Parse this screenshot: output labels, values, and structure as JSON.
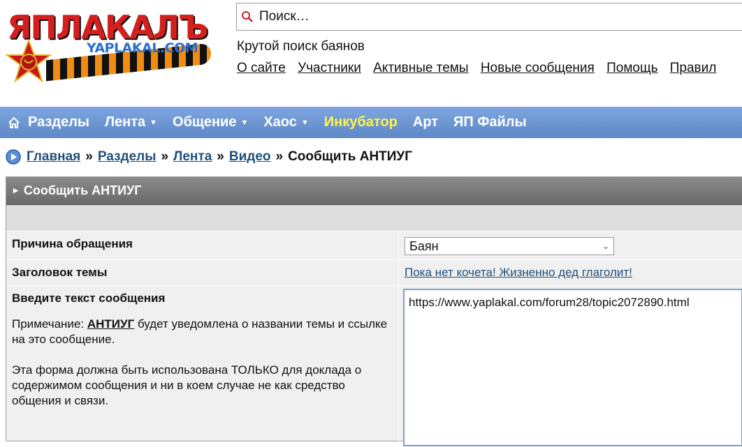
{
  "logo": {
    "text": "ЯПЛАКАЛЪ",
    "sub": "YAPLAKAL.COM"
  },
  "search": {
    "placeholder": "Поиск…"
  },
  "tagline": "Крутой поиск баянов",
  "top_links": [
    "О сайте",
    "Участники",
    "Активные темы",
    "Новые сообщения",
    "Помощь",
    "Правил"
  ],
  "nav": {
    "items": [
      {
        "label": "Разделы"
      },
      {
        "label": "Лента",
        "caret": "▼"
      },
      {
        "label": "Общение",
        "caret": "▼"
      },
      {
        "label": "Хаос",
        "caret": "▼"
      },
      {
        "label": "Инкубатор",
        "highlight_color": "#fff44a"
      },
      {
        "label": "Арт"
      },
      {
        "label": "ЯП Файлы"
      }
    ]
  },
  "breadcrumb": {
    "links": [
      "Главная",
      "Разделы",
      "Лента",
      "Видео"
    ],
    "separator": "»",
    "current": "Сообщить АНТИУГ"
  },
  "panel": {
    "title": "Сообщить АНТИУГ",
    "reason_label": "Причина обращения",
    "reason_value": "Баян",
    "topic_label": "Заголовок темы",
    "topic_value": "Пока нет кочета! Жизненно дед глаголит!",
    "message_label": "Введите текст сообщения",
    "note_prefix": "Примечание: ",
    "note_bold": "АНТИУГ",
    "note_suffix": " будет уведомлена о названии темы и ссылке на это сообщение.",
    "note_2": "Эта форма должна быть использована ТОЛЬКО для доклада о содержимом сообщения и ни в коем случае не как средство общения и связи.",
    "message_value": "https://www.yaplakal.com/forum28/topic2072890.html"
  },
  "colors": {
    "nav_top": "#7fa6df",
    "nav_bottom": "#5d88c6",
    "link": "#1f4f7a",
    "logo_red": "#d41f1f"
  }
}
